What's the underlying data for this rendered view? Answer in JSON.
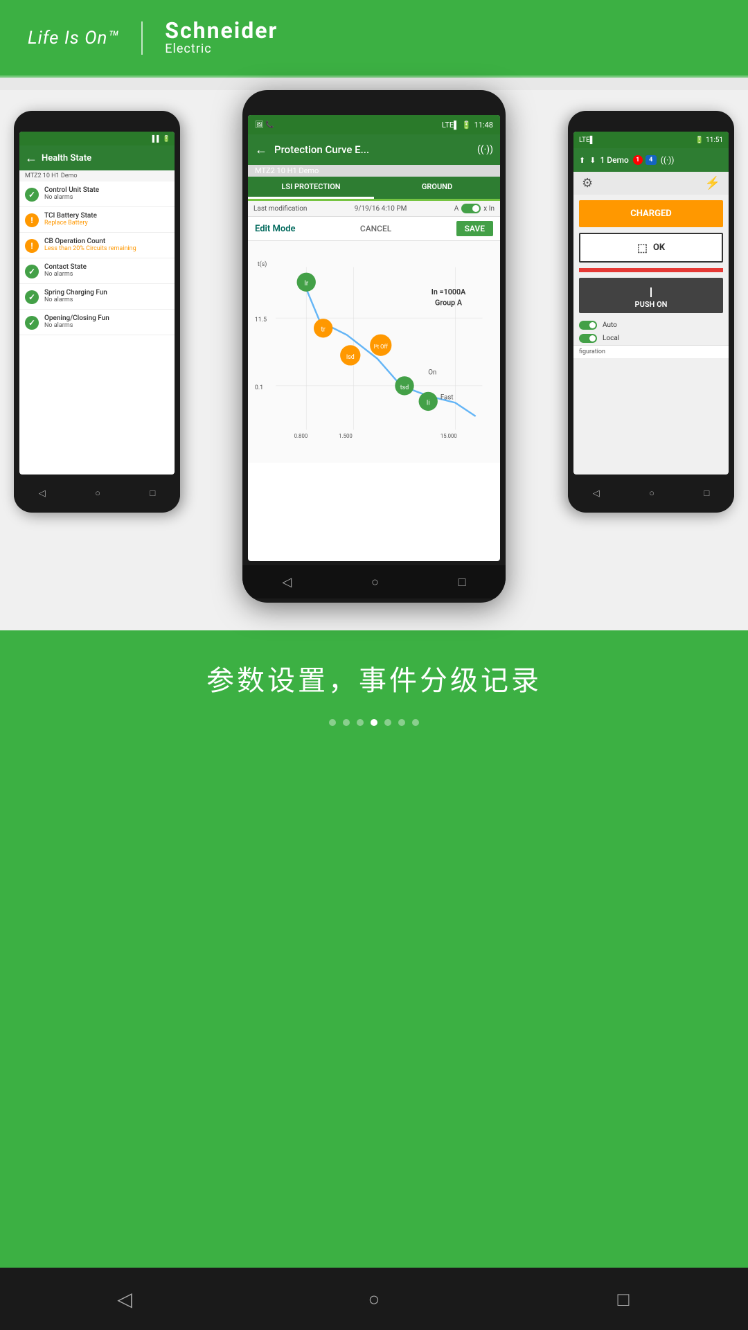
{
  "header": {
    "life_is_on": "Life Is On™",
    "brand": "Schneider",
    "brand_sub": "Electric"
  },
  "left_phone": {
    "title": "Health State",
    "subtitle": "MTZ2 10 H1 Demo",
    "items": [
      {
        "label": "Control Unit State",
        "status": "No alarms",
        "type": "ok"
      },
      {
        "label": "TCI Battery State",
        "status": "Replace Battery",
        "type": "warn"
      },
      {
        "label": "CB Operation Count",
        "status": "Less than 20% Circuits remaining",
        "type": "warn"
      },
      {
        "label": "Contact State",
        "status": "No alarms",
        "type": "ok"
      },
      {
        "label": "Spring Charging Fun",
        "status": "No alarms",
        "type": "ok"
      },
      {
        "label": "Opening/Closing Fun",
        "status": "No alarms",
        "type": "ok"
      }
    ]
  },
  "center_phone": {
    "status_bar": {
      "time": "11:48"
    },
    "app_bar": {
      "title": "Protection Curve E...",
      "subtitle": "MTZ2 10 H1 Demo"
    },
    "tabs": [
      {
        "label": "LSI PROTECTION",
        "active": true
      },
      {
        "label": "GROUND",
        "active": false
      }
    ],
    "last_mod": {
      "label": "Last modification",
      "date": "9/19/16 4:10 PM"
    },
    "toggle_label": "A",
    "toggle_suffix": "x In",
    "edit_mode": {
      "label": "Edit Mode",
      "cancel": "CANCEL",
      "save": "SAVE"
    },
    "chart": {
      "y_label1": "11.5",
      "y_label2": "0.1",
      "x_label1": "0.800",
      "x_label2": "1.500",
      "x_label3": "15.000",
      "annotation": "In =1000A\nGroup A",
      "on_label": "On",
      "fast_label": "Fast",
      "points": [
        "Ir",
        "tr",
        "Isd",
        "I²t Off",
        "tsd",
        "li"
      ]
    }
  },
  "right_phone": {
    "status_bar": {
      "time": "11:51"
    },
    "app_bar": {
      "title": "1 Demo",
      "badge1": "1",
      "badge2": "4"
    },
    "charged_label": "CHARGED",
    "ok_label": "OK",
    "push_on_label": "PUSH ON",
    "toggles": [
      {
        "label": "Auto",
        "on": true
      },
      {
        "label": "Local",
        "on": true
      }
    ],
    "configuration": "figuration"
  },
  "caption": "参数设置，事件分级记录",
  "dots": [
    {
      "active": false
    },
    {
      "active": false
    },
    {
      "active": false
    },
    {
      "active": true
    },
    {
      "active": false
    },
    {
      "active": false
    },
    {
      "active": false
    }
  ],
  "bottom_nav": {
    "back": "◁",
    "home": "○",
    "recent": "□"
  }
}
